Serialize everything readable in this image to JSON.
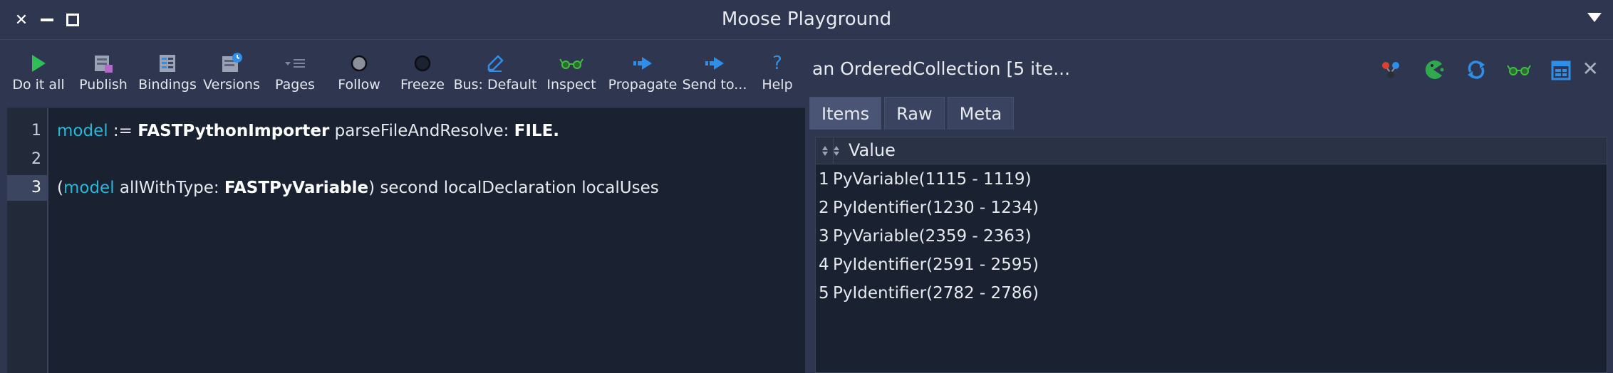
{
  "window": {
    "title": "Moose Playground"
  },
  "toolbar": {
    "items": [
      {
        "label": "Do it all",
        "icon": "play-icon"
      },
      {
        "label": "Publish",
        "icon": "publish-icon"
      },
      {
        "label": "Bindings",
        "icon": "bindings-icon"
      },
      {
        "label": "Versions",
        "icon": "versions-icon"
      },
      {
        "label": "Pages",
        "icon": "pages-icon"
      },
      {
        "label": "Follow",
        "icon": "follow-circle-icon"
      },
      {
        "label": "Freeze",
        "icon": "freeze-circle-icon"
      },
      {
        "label": "Bus: Default",
        "icon": "bus-pen-icon"
      },
      {
        "label": "Inspect",
        "icon": "glasses-icon"
      },
      {
        "label": "Propagate",
        "icon": "propagate-arrow-icon"
      },
      {
        "label": "Send to...",
        "icon": "send-arrow-icon"
      },
      {
        "label": "Help",
        "icon": "help-icon"
      }
    ]
  },
  "editor": {
    "line_numbers": [
      "1",
      "2",
      "3"
    ],
    "line1": {
      "var": "model",
      "op": " := ",
      "cls": "FASTPythonImporter",
      "msg": " parseFileAndResolve: ",
      "arg": "FILE."
    },
    "line3": {
      "open": "(",
      "var": "model",
      "msg1": " allWithType: ",
      "cls": "FASTPyVariable",
      "rest": ") second localDeclaration localUses"
    }
  },
  "inspector": {
    "title": "an OrderedCollection [5 ite...",
    "tools": [
      "tree-icon",
      "pacman-icon",
      "refresh-icon",
      "glasses-icon",
      "window-icon"
    ],
    "close_glyph": "✕",
    "tabs": [
      {
        "label": "Items",
        "selected": true
      },
      {
        "label": "Raw",
        "selected": false
      },
      {
        "label": "Meta",
        "selected": false
      }
    ],
    "table": {
      "column": "Value",
      "rows": [
        {
          "index": "1",
          "value": "PyVariable(1115 - 1119)"
        },
        {
          "index": "2",
          "value": "PyIdentifier(1230 - 1234)"
        },
        {
          "index": "3",
          "value": "PyVariable(2359 - 2363)"
        },
        {
          "index": "4",
          "value": "PyIdentifier(2591 - 2595)"
        },
        {
          "index": "5",
          "value": "PyIdentifier(2782 - 2786)"
        }
      ]
    }
  },
  "colors": {
    "background": "#2e3650",
    "editor_bg": "#1a2130",
    "variable": "#27b8d8",
    "play_green": "#2fbf57",
    "accent_blue": "#2f8fe8"
  }
}
